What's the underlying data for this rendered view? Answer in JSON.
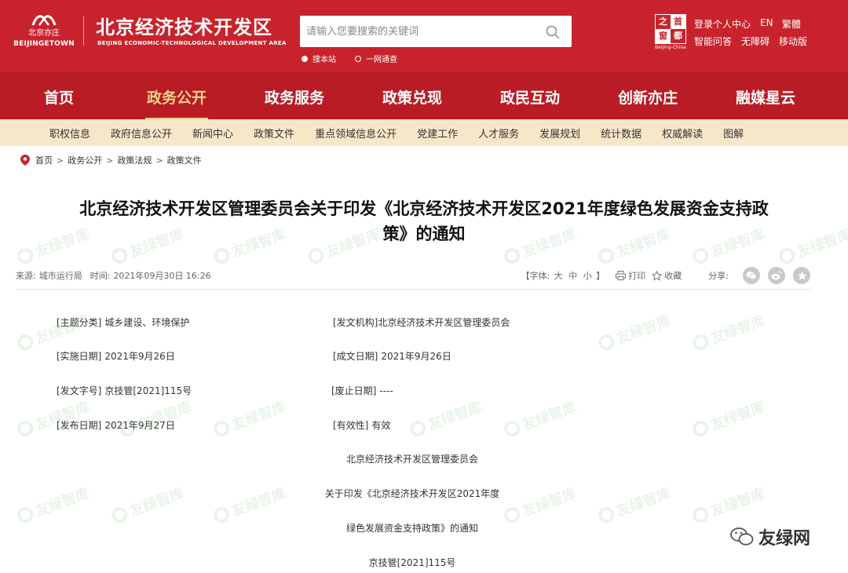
{
  "header": {
    "logo_cn": "北京亦庄",
    "logo_en": "BEIJINGETOWN",
    "site_title": "北京经济技术开发区",
    "site_subtitle": "BEIJING ECONOMIC-TECHNOLOGICAL DEVELOPMENT AREA",
    "search_placeholder": "请输入您要搜索的关键词",
    "search_scopes": [
      "搜本站",
      "一网通查"
    ],
    "seal_chars": [
      "之",
      "首",
      "窗",
      "都"
    ],
    "seal_en": "Beijing-China",
    "tools": [
      "登录个人中心",
      "EN",
      "繁體",
      "智能问答",
      "无障碍",
      "移动版"
    ]
  },
  "main_nav": {
    "items": [
      "首页",
      "政务公开",
      "政务服务",
      "政策兑现",
      "政民互动",
      "创新亦庄",
      "融媒星云"
    ],
    "active": "政务公开"
  },
  "sub_nav": {
    "items": [
      "职权信息",
      "政府信息公开",
      "新闻中心",
      "政策文件",
      "重点领域信息公开",
      "党建工作",
      "人才服务",
      "发展规划",
      "统计数据",
      "权威解读",
      "图解"
    ]
  },
  "breadcrumb": [
    "首页",
    "政务公开",
    "政策法规",
    "政策文件"
  ],
  "article": {
    "title_line1": "北京经济技术开发区管理委员会关于印发《北京经济技术开发区2021年度绿色发展资金支持政",
    "title_line2": "策》的通知",
    "source_label": "来源:",
    "source": "城市运行局",
    "time_label": "时间:",
    "time": "2021年09月30日 16:26",
    "font_label": "【字体:",
    "font_sizes": [
      "大",
      "中",
      "小"
    ],
    "font_end": "】",
    "print": "打印",
    "favorite": "收藏",
    "share_label": "分享:"
  },
  "info": {
    "topic_k": "[主题分类]",
    "topic_v": "城乡建设、环境保护",
    "issuer_k": "[发文机构]",
    "issuer_v": "北京经济技术开发区管理委员会",
    "impl_k": "[实施日期]",
    "impl_v": "2021年9月26日",
    "created_k": "[成文日期]",
    "created_v": "2021年9月26日",
    "docno_k": "[发文字号]",
    "docno_v": "京技管[2021]115号",
    "expire_k": "[废止日期]",
    "expire_v": "----",
    "publish_k": "[发布日期]",
    "publish_v": "2021年9月27日",
    "valid_k": "[有效性]",
    "valid_v": "有效"
  },
  "body": [
    "北京经济技术开发区管理委员会",
    "关于印发《北京经济技术开发区2021年度",
    "绿色发展资金支持政策》的通知",
    "京技管[2021]115号"
  ],
  "watermark_text": "友绿智库",
  "badge_text": "友绿网",
  "colors": {
    "primary": "#c8232c",
    "subnav": "#f7e7c9",
    "active": "#f5d48b"
  }
}
